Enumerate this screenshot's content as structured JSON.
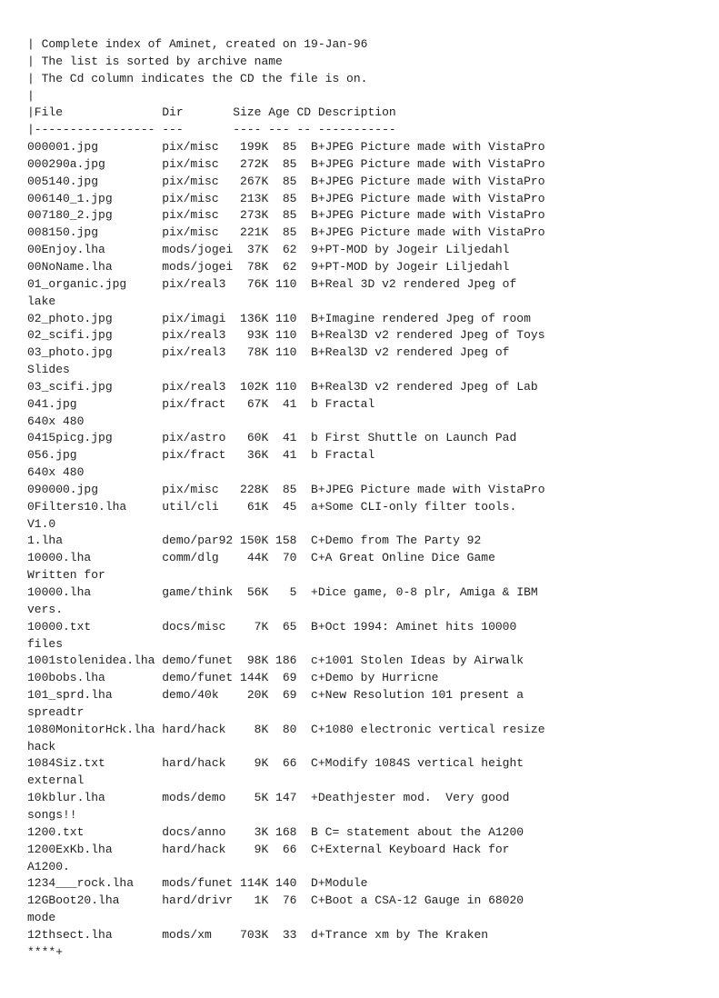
{
  "content": "| Complete index of Aminet, created on 19-Jan-96\n| The list is sorted by archive name\n| The Cd column indicates the CD the file is on.\n|\n|File              Dir       Size Age CD Description\n|----------------- ---       ---- --- -- -----------\n000001.jpg         pix/misc   199K  85  B+JPEG Picture made with VistaPro\n000290a.jpg        pix/misc   272K  85  B+JPEG Picture made with VistaPro\n005140.jpg         pix/misc   267K  85  B+JPEG Picture made with VistaPro\n006140_1.jpg       pix/misc   213K  85  B+JPEG Picture made with VistaPro\n007180_2.jpg       pix/misc   273K  85  B+JPEG Picture made with VistaPro\n008150.jpg         pix/misc   221K  85  B+JPEG Picture made with VistaPro\n00Enjoy.lha        mods/jogei  37K  62  9+PT-MOD by Jogeir Liljedahl\n00NoName.lha       mods/jogei  78K  62  9+PT-MOD by Jogeir Liljedahl\n01_organic.jpg     pix/real3   76K 110  B+Real 3D v2 rendered Jpeg of\nlake\n02_photo.jpg       pix/imagi  136K 110  B+Imagine rendered Jpeg of room\n02_scifi.jpg       pix/real3   93K 110  B+Real3D v2 rendered Jpeg of Toys\n03_photo.jpg       pix/real3   78K 110  B+Real3D v2 rendered Jpeg of\nSlides\n03_scifi.jpg       pix/real3  102K 110  B+Real3D v2 rendered Jpeg of Lab\n041.jpg            pix/fract   67K  41  b Fractal\n640x 480\n0415picg.jpg       pix/astro   60K  41  b First Shuttle on Launch Pad\n056.jpg            pix/fract   36K  41  b Fractal\n640x 480\n090000.jpg         pix/misc   228K  85  B+JPEG Picture made with VistaPro\n0Filters10.lha     util/cli    61K  45  a+Some CLI-only filter tools.\nV1.0\n1.lha              demo/par92 150K 158  C+Demo from The Party 92\n10000.lha          comm/dlg    44K  70  C+A Great Online Dice Game\nWritten for\n10000.lha          game/think  56K   5  +Dice game, 0-8 plr, Amiga & IBM\nvers.\n10000.txt          docs/misc    7K  65  B+Oct 1994: Aminet hits 10000\nfiles\n1001stolenidea.lha demo/funet  98K 186  c+1001 Stolen Ideas by Airwalk\n100bobs.lha        demo/funet 144K  69  c+Demo by Hurricne\n101_sprd.lha       demo/40k    20K  69  c+New Resolution 101 present a\nspreadtr\n1080MonitorHck.lha hard/hack    8K  80  C+1080 electronic vertical resize\nhack\n1084Siz.txt        hard/hack    9K  66  C+Modify 1084S vertical height\nexternal\n10kblur.lha        mods/demo    5K 147  +Deathjester mod.  Very good\nsongs!!\n1200.txt           docs/anno    3K 168  B C= statement about the A1200\n1200ExKb.lha       hard/hack    9K  66  C+External Keyboard Hack for\nA1200.\n1234___rock.lha    mods/funet 114K 140  D+Module\n12GBoot20.lha      hard/drivr   1K  76  C+Boot a CSA-12 Gauge in 68020\nmode\n12thsect.lha       mods/xm    703K  33  d+Trance xm by The Kraken\n****+"
}
